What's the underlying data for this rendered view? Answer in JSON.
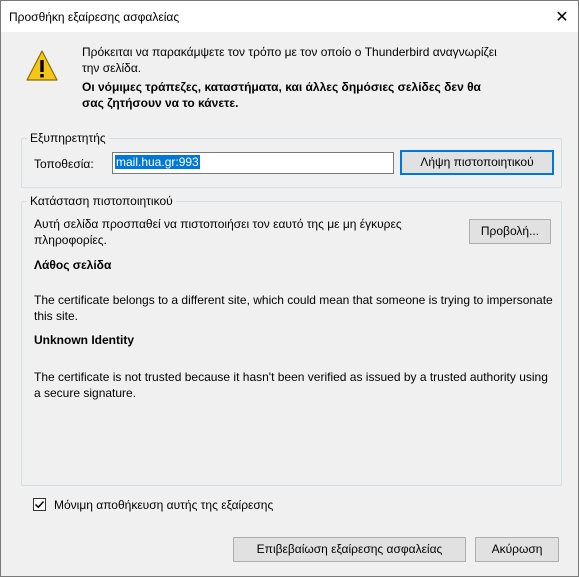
{
  "window": {
    "title": "Προσθήκη εξαίρεσης ασφαλείας",
    "close_glyph": "✕"
  },
  "warning": {
    "icon": "warning-triangle-icon",
    "intro": "Πρόκειται να παρακάμψετε τον τρόπο με τον οποίο ο Thunderbird αναγνωρίζει την σελίδα.",
    "bold_line": "Οι νόμιμες τράπεζες, καταστήματα, και άλλες δημόσιες σελίδες δεν θα σας ζητήσουν να το κάνετε."
  },
  "server": {
    "group_label": "Εξυπηρετητής",
    "location_label": "Τοποθεσία:",
    "location_value": "mail.hua.gr:993",
    "get_cert_button": "Λήψη πιστοποιητικού"
  },
  "cert_status": {
    "group_label": "Κατάσταση πιστοποιητικού",
    "description": "Αυτή σελίδα προσπαθεί να πιστοποιήσει τον εαυτό της με μη έγκυρες πληροφορίες.",
    "view_button": "Προβολή...",
    "wrong_site_title": "Λάθος σελίδα",
    "wrong_site_text": "The certificate belongs to a different site, which could mean that someone is trying to impersonate this site.",
    "unknown_identity_title": "Unknown Identity",
    "unknown_identity_text": "The certificate is not trusted because it hasn't been verified as issued by a trusted authority using a secure signature."
  },
  "permanent": {
    "label": "Μόνιμη αποθήκευση αυτής της εξαίρεσης",
    "checked": true
  },
  "footer": {
    "confirm_button": "Επιβεβαίωση εξαίρεσης ασφαλείας",
    "cancel_button": "Ακύρωση"
  },
  "colors": {
    "selection": "#0078d7",
    "warning_yellow": "#f5c518",
    "dialog_bg": "#f0f0f0"
  }
}
